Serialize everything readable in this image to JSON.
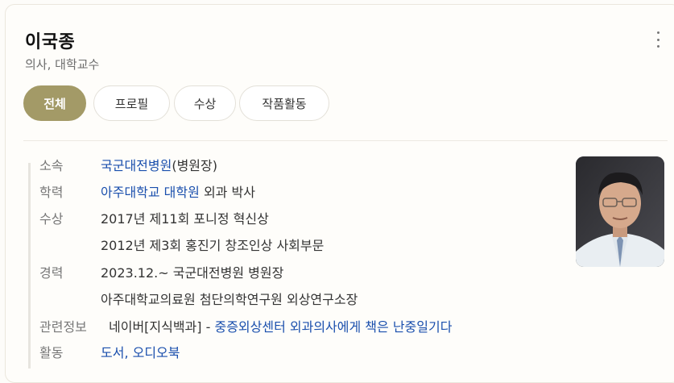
{
  "profile": {
    "name": "이국종",
    "subtitle": "의사, 대학교수"
  },
  "tabs": [
    {
      "label": "전체",
      "active": true
    },
    {
      "label": "프로필",
      "active": false
    },
    {
      "label": "수상",
      "active": false
    },
    {
      "label": "작품활동",
      "active": false
    }
  ],
  "info": {
    "affiliation": {
      "label": "소속",
      "link": "국군대전병원",
      "suffix": "(병원장)"
    },
    "education": {
      "label": "학력",
      "link": "아주대학교 대학원",
      "suffix": " 외과 박사"
    },
    "awards": {
      "label": "수상",
      "items": [
        "2017년 제11회 포니정 혁신상",
        "2012년 제3회 홍진기 창조인상 사회부문"
      ]
    },
    "career": {
      "label": "경력",
      "items": [
        "2023.12.~ 국군대전병원 병원장",
        "아주대학교의료원 첨단의학연구원 외상연구소장"
      ]
    },
    "related": {
      "label": "관련정보",
      "source": "네이버[지식백과]",
      "separator": " - ",
      "link": "중증외상센터 외과의사에게 책은 난중일기다"
    },
    "activity": {
      "label": "활동",
      "link": "도서, 오디오북"
    }
  },
  "photo": {
    "icon": "person-photo"
  },
  "colors": {
    "accent": "#a39a67",
    "link": "#1a4fad",
    "label": "#777777"
  }
}
